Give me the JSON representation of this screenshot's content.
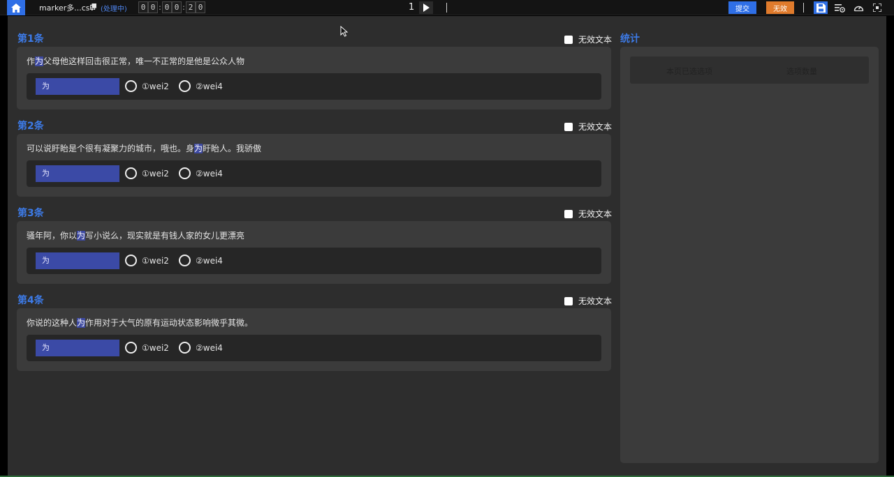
{
  "topbar": {
    "file_name": "marker多...csv",
    "status": "(处理中)",
    "timer_digits": [
      "0",
      "0",
      "0",
      "0",
      "2",
      "0"
    ],
    "timer_sep": ":",
    "page": "1",
    "submit_label": "提交",
    "invalid_label": "无效"
  },
  "items": [
    {
      "title": "第1条",
      "invalid_label": "无效文本",
      "sentence_pre": "作",
      "sentence_hl": "为",
      "sentence_post": "父母他这样回击很正常，唯一不正常的是他是公众人物",
      "target": "为",
      "options": [
        "①wei2",
        "②wei4"
      ]
    },
    {
      "title": "第2条",
      "invalid_label": "无效文本",
      "sentence_pre": "可以说盱眙是个很有凝聚力的城市，哦也。身",
      "sentence_hl": "为",
      "sentence_post": "盱眙人。我骄傲",
      "target": "为",
      "options": [
        "①wei2",
        "②wei4"
      ]
    },
    {
      "title": "第3条",
      "invalid_label": "无效文本",
      "sentence_pre": "骚年阿，你以",
      "sentence_hl": "为",
      "sentence_post": "写小说么，现实就是有钱人家的女儿更漂亮",
      "target": "为",
      "options": [
        "①wei2",
        "②wei4"
      ]
    },
    {
      "title": "第4条",
      "invalid_label": "无效文本",
      "sentence_pre": "你说的这种人",
      "sentence_hl": "为",
      "sentence_post": "作用对于大气的原有运动状态影响微乎其微。",
      "target": "为",
      "options": [
        "①wei2",
        "②wei4"
      ]
    }
  ],
  "stats": {
    "title": "统计",
    "col_selected": "本页已选选项",
    "col_count": "选项数量"
  },
  "colors": {
    "accent": "#3d7be8",
    "submit": "#2f6fe6",
    "invalid": "#e07b2c",
    "highlight": "#3d49a0"
  }
}
